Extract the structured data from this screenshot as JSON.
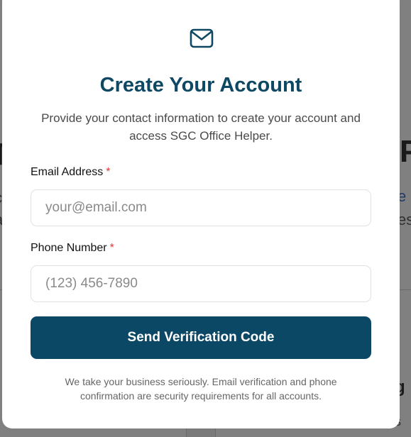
{
  "backdrop": {
    "heading_left": "T",
    "heading_right": "P",
    "line_left_1": "c",
    "line_left_2": "a",
    "line_right_1": "e p",
    "line_right_2": "es",
    "bottom_right_1": "g",
    "bottom_right_2": "s"
  },
  "modal": {
    "icon": "mail-icon",
    "title": "Create Your Account",
    "subtitle": "Provide your contact information to create your account and access SGC Office Helper.",
    "email": {
      "label": "Email Address",
      "required_mark": "*",
      "placeholder": "your@email.com",
      "value": ""
    },
    "phone": {
      "label": "Phone Number",
      "required_mark": "*",
      "placeholder": "(123) 456-7890",
      "value": ""
    },
    "send_button_label": "Send Verification Code",
    "footnote": "We take your business seriously. Email verification and phone confirmation are security requirements for all accounts."
  },
  "colors": {
    "primary": "#0b4866",
    "title": "#0f4863",
    "required": "#e53935",
    "overlay": "#808080"
  }
}
